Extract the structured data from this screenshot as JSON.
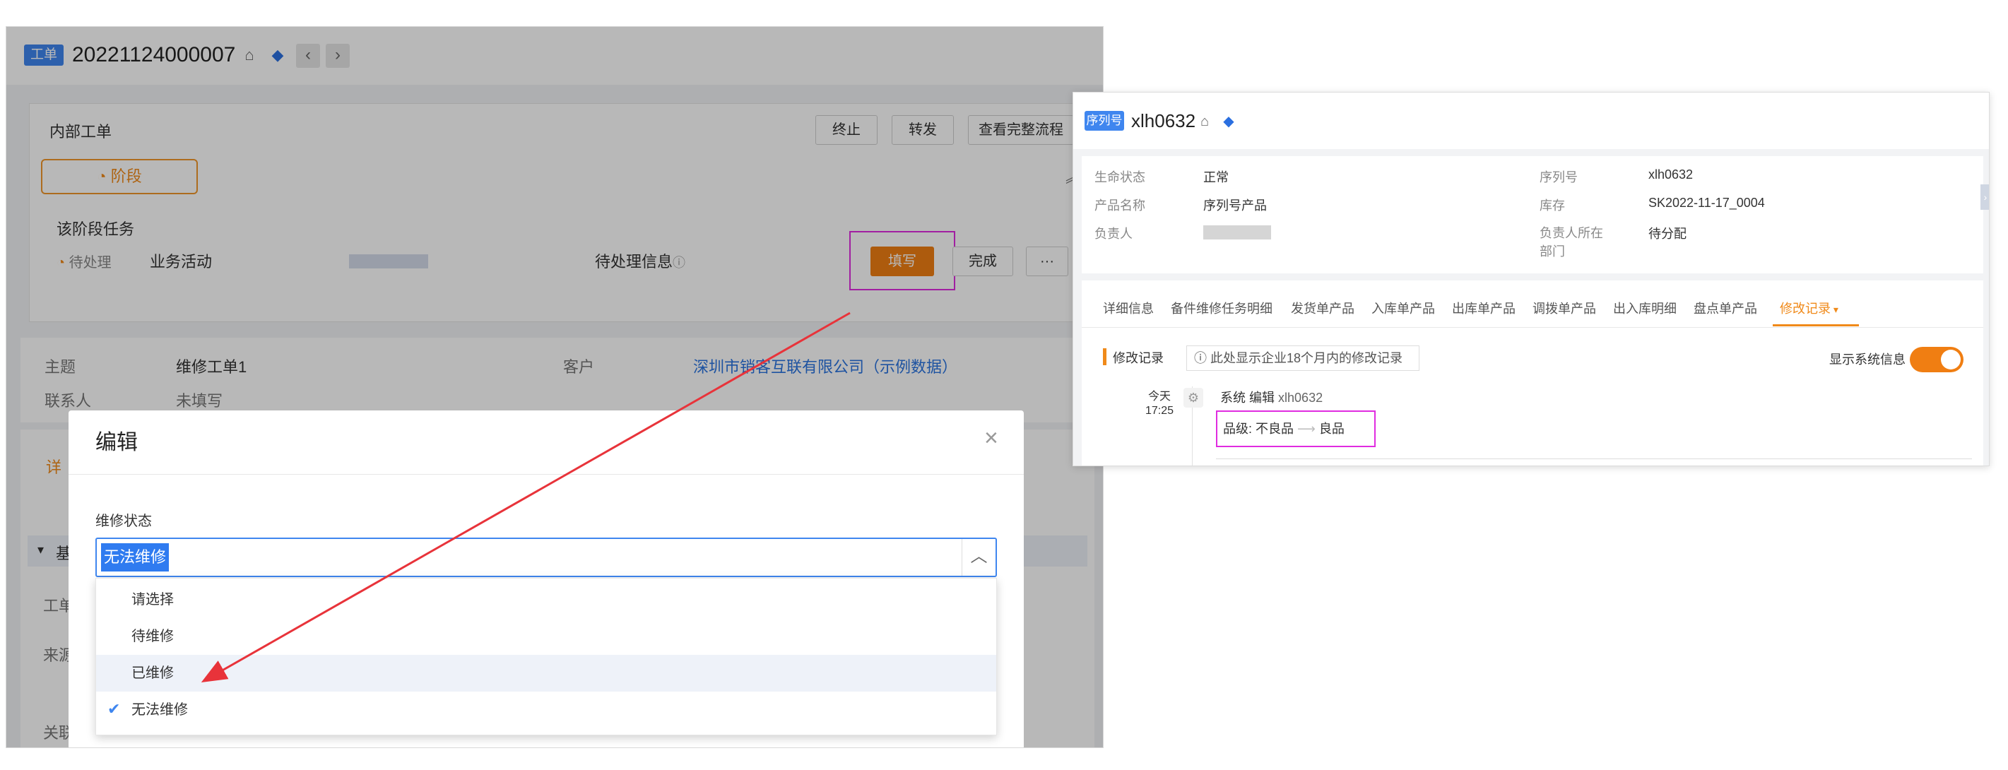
{
  "left": {
    "badge": "工单",
    "order_id": "20221124000007",
    "lock_icon": "lock-icon",
    "tag_icon": "tag-icon",
    "nav_prev": "‹",
    "nav_next": "›",
    "card_title": "内部工单",
    "buttons": {
      "terminate": "终止",
      "forward": "转发",
      "view_flow": "查看完整流程"
    },
    "stage_label": "阶段",
    "stage_tasks_title": "该阶段任务",
    "task_status": "待处理",
    "task_name": "业务活动",
    "pending_info": "待处理信息",
    "fill_button": "填写",
    "complete_button": "完成",
    "more_button": "···",
    "info": {
      "subject_label": "主题",
      "subject_value": "维修工单1",
      "customer_label": "客户",
      "customer_value": "深圳市销客互联有限公司（示例数据）",
      "contact_label": "联系人",
      "contact_value": "未填写"
    },
    "partial_labels": {
      "detail_tab": "详",
      "section_base": "基",
      "field_1": "工单",
      "field_2": "来源",
      "field_3": "关联"
    }
  },
  "modal": {
    "title": "编辑",
    "close": "×",
    "field_label": "维修状态",
    "selected_value": "无法维修",
    "translate_icon": "文A",
    "options": [
      "请选择",
      "待维修",
      "已维修",
      "无法维修"
    ],
    "checked_option_index": 3,
    "hovered_option_index": 2
  },
  "right": {
    "badge": "序列号",
    "title": "xlh0632",
    "info": [
      {
        "label": "生命状态",
        "value": "正常",
        "link": false
      },
      {
        "label": "序列号",
        "value": "xlh0632",
        "link": false
      },
      {
        "label": "产品名称",
        "value": "序列号产品",
        "link": true
      },
      {
        "label": "库存",
        "value": "SK2022-11-17_0004",
        "link": true
      },
      {
        "label": "负责人",
        "value": "",
        "link": false
      },
      {
        "label": "负责人所在部门",
        "value": "待分配",
        "link": false
      }
    ],
    "tabs": [
      "详细信息",
      "备件维修任务明细",
      "发货单产品",
      "入库单产品",
      "出库单产品",
      "调拨单产品",
      "出入库明细",
      "盘点单产品",
      "修改记录"
    ],
    "active_tab": "修改记录",
    "section_title": "修改记录",
    "note": "此处显示企业18个月内的修改记录",
    "show_system_label": "显示系统信息",
    "record": {
      "day": "今天",
      "time": "17:25",
      "actor": "系统 编辑",
      "target": "xlh0632",
      "field": "品级:",
      "from": "不良品",
      "to": "良品"
    }
  },
  "colors": {
    "brand_blue": "#3f86ef",
    "accent_orange": "#f07e12",
    "highlight_pink": "#e02ce0",
    "arrow_red": "#e8333a",
    "link_blue": "#2a74e0"
  }
}
